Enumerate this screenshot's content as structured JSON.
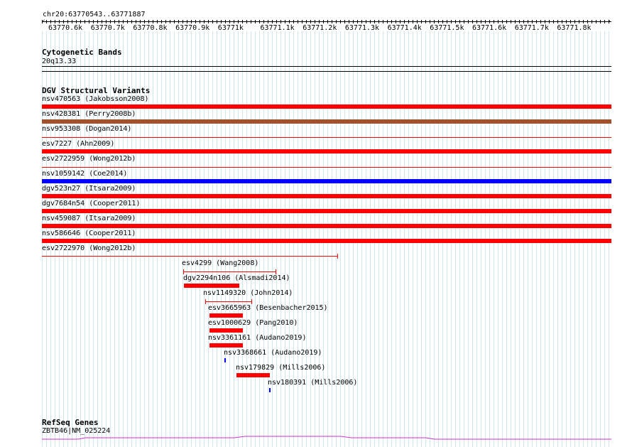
{
  "locus": "chr20:63770543..63771887",
  "ruler": {
    "labels": [
      "63770.6k",
      "63770.7k",
      "63770.8k",
      "63770.9k",
      "63771k",
      "63771.1k",
      "63771.2k",
      "63771.3k",
      "63771.4k",
      "63771.5k",
      "63771.6k",
      "63771.7k",
      "63771.8k"
    ]
  },
  "cytoband": {
    "title": "Cytogenetic Bands",
    "label": "20q13.33"
  },
  "dgv": {
    "title": "DGV Structural Variants",
    "variants": [
      {
        "label": "nsv470563 (Jakobsson2008)",
        "color": "#ff0000",
        "style": "bar"
      },
      {
        "label": "nsv428381 (Perry2008b)",
        "color": "#a0522d",
        "style": "bar"
      },
      {
        "label": "nsv953308 (Dogan2014)",
        "color": "#ff0000",
        "style": "line"
      },
      {
        "label": "esv7227 (Ahn2009)",
        "color": "#ff0000",
        "style": "bar"
      },
      {
        "label": "esv2722959 (Wong2012b)",
        "color": "#ff0000",
        "style": "line"
      },
      {
        "label": "nsv1059142 (Coe2014)",
        "color": "#0000ff",
        "style": "bar"
      },
      {
        "label": "dgv523n27 (Itsara2009)",
        "color": "#ff0000",
        "style": "bar"
      },
      {
        "label": "dgv7684n54 (Cooper2011)",
        "color": "#ff0000",
        "style": "bar"
      },
      {
        "label": "nsv459087 (Itsara2009)",
        "color": "#ff0000",
        "style": "bar"
      },
      {
        "label": "nsv586646 (Cooper2011)",
        "color": "#ff0000",
        "style": "bar"
      },
      {
        "label": "esv2722970 (Wong2012b)",
        "color": "#ff0000",
        "style": "line"
      },
      {
        "label": "esv4299 (Wang2008)",
        "color": "#ff0000",
        "style": "line"
      },
      {
        "label": "dgv2294n106 (Alsmadi2014)",
        "color": "#ff0000",
        "style": "bar"
      },
      {
        "label": "nsv1149320 (John2014)",
        "color": "#ff0000",
        "style": "line"
      },
      {
        "label": "esv3665963 (Besenbacher2015)",
        "color": "#ff0000",
        "style": "bar"
      },
      {
        "label": "esv1000629 (Pang2010)",
        "color": "#ff0000",
        "style": "bar"
      },
      {
        "label": "nsv3361161 (Audano2019)",
        "color": "#ff0000",
        "style": "bar"
      },
      {
        "label": "nsv3368661 (Audano2019)",
        "color": "#0000ff",
        "style": "bar"
      },
      {
        "label": "nsv179829 (Mills2006)",
        "color": "#ff0000",
        "style": "bar"
      },
      {
        "label": "nsv180391 (Mills2006)",
        "color": "#0000ff",
        "style": "bar"
      }
    ]
  },
  "refseq": {
    "title": "RefSeq Genes",
    "label": "ZBTB46|NM_025224",
    "color": "#cc33cc"
  }
}
